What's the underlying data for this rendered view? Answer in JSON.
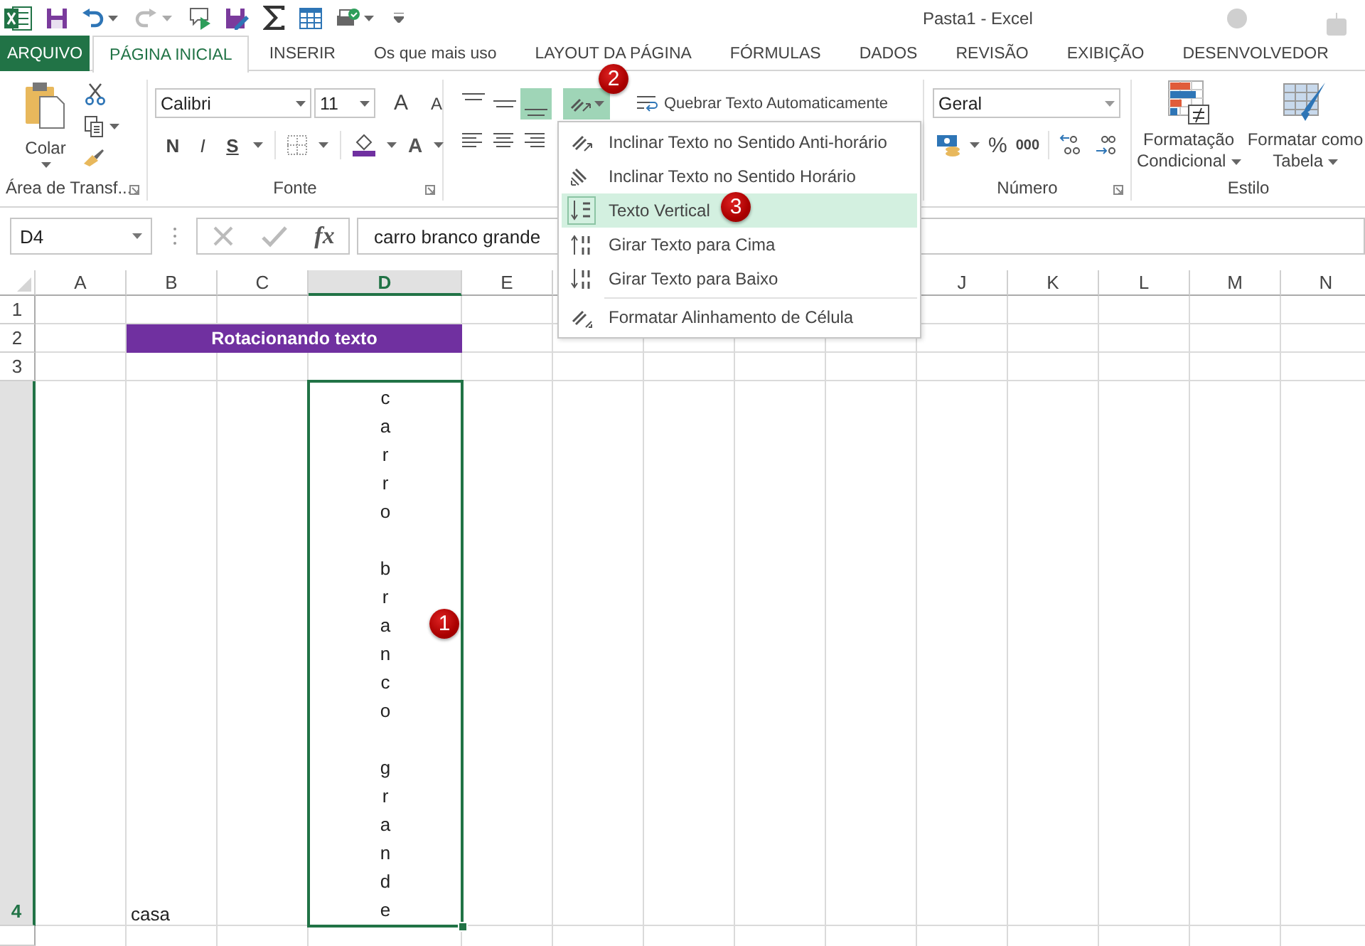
{
  "window": {
    "title": "Pasta1 - Excel"
  },
  "tabs": [
    {
      "label": "ARQUIVO",
      "kind": "file",
      "selected": false
    },
    {
      "label": "PÁGINA INICIAL",
      "kind": "tab",
      "selected": true
    },
    {
      "label": "INSERIR",
      "kind": "tab",
      "selected": false
    },
    {
      "label": "Os que mais uso",
      "kind": "tab",
      "selected": false
    },
    {
      "label": "LAYOUT DA PÁGINA",
      "kind": "tab",
      "selected": false
    },
    {
      "label": "FÓRMULAS",
      "kind": "tab",
      "selected": false
    },
    {
      "label": "DADOS",
      "kind": "tab",
      "selected": false
    },
    {
      "label": "REVISÃO",
      "kind": "tab",
      "selected": false
    },
    {
      "label": "EXIBIÇÃO",
      "kind": "tab",
      "selected": false
    },
    {
      "label": "DESENVOLVEDOR",
      "kind": "tab",
      "selected": false
    }
  ],
  "ribbon": {
    "clipboard": {
      "paste": "Colar",
      "group_label": "Área de Transf..."
    },
    "font": {
      "font_name": "Calibri",
      "font_size": "11",
      "grow": "A",
      "shrink": "A",
      "bold": "N",
      "italic": "I",
      "underline": "S",
      "font_color": "A",
      "group_label": "Fonte"
    },
    "alignment": {
      "bottom_align_pressed": true,
      "orientation_pressed": true,
      "wrap_text": "Quebrar Texto Automaticamente"
    },
    "number": {
      "format": "Geral",
      "percent": "%",
      "thousands": "000",
      "group_label": "Número"
    },
    "styles": {
      "conditional": "Formatação Condicional",
      "table": "Formatar como Tabela",
      "group_label": "Estilo"
    }
  },
  "formula_bar": {
    "name_box": "D4",
    "insert_function": "fx",
    "formula": "carro branco grande"
  },
  "orientation_menu": [
    {
      "label": "Inclinar Texto no Sentido Anti-horário",
      "kind": "ccw",
      "selected": false
    },
    {
      "label": "Inclinar Texto no Sentido Horário",
      "kind": "cw",
      "selected": false
    },
    {
      "label": "Texto Vertical",
      "kind": "vertical",
      "selected": true
    },
    {
      "label": "Girar Texto para Cima",
      "kind": "up",
      "selected": false
    },
    {
      "label": "Girar Texto para Baixo",
      "kind": "down",
      "selected": false
    },
    {
      "label": "Formatar Alinhamento de Célula",
      "kind": "format",
      "selected": false
    }
  ],
  "sheet": {
    "columns": [
      {
        "label": "A",
        "selected": false
      },
      {
        "label": "B",
        "selected": false
      },
      {
        "label": "C",
        "selected": false
      },
      {
        "label": "D",
        "selected": true
      },
      {
        "label": "E",
        "selected": false
      },
      {
        "label": "J",
        "selected": false
      },
      {
        "label": "K",
        "selected": false
      },
      {
        "label": "L",
        "selected": false
      },
      {
        "label": "M",
        "selected": false
      },
      {
        "label": "N",
        "selected": false
      }
    ],
    "rows": [
      {
        "label": "1",
        "selected": false
      },
      {
        "label": "2",
        "selected": false
      },
      {
        "label": "3",
        "selected": false
      },
      {
        "label": "4",
        "selected": true
      }
    ],
    "cells": [
      {
        "kind": "banner",
        "text": "Rotacionando texto"
      },
      {
        "kind": "vertical",
        "text": "carro branco grande",
        "selected": true
      },
      {
        "kind": "plain",
        "text": "casa"
      }
    ]
  },
  "callouts": [
    {
      "text": "1"
    },
    {
      "text": "2"
    },
    {
      "text": "3"
    }
  ]
}
